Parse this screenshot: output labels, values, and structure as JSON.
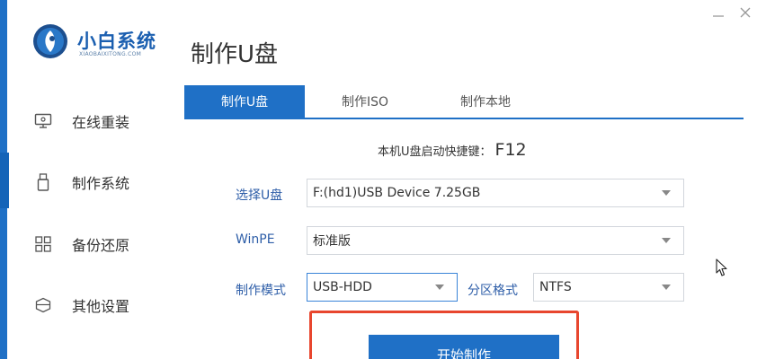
{
  "app": {
    "logo_title": "小白系统",
    "logo_subtitle": "XIAOBAIXITONG.COM"
  },
  "sidebar": {
    "items": [
      {
        "label": "在线重装",
        "icon": "monitor-icon"
      },
      {
        "label": "制作系统",
        "icon": "usb-drive-icon"
      },
      {
        "label": "备份还原",
        "icon": "grid-icon"
      },
      {
        "label": "其他设置",
        "icon": "cube-icon"
      }
    ]
  },
  "page_title": "制作U盘",
  "tabs": [
    {
      "label": "制作U盘",
      "active": true
    },
    {
      "label": "制作ISO",
      "active": false
    },
    {
      "label": "制作本地",
      "active": false
    }
  ],
  "hotkey": {
    "label": "本机U盘启动快捷键：",
    "key": "F12"
  },
  "form": {
    "usb_label": "选择U盘",
    "usb_value": "F:(hd1)USB Device 7.25GB",
    "winpe_label": "WinPE",
    "winpe_value": "标准版",
    "mode_label": "制作模式",
    "mode_value": "USB-HDD",
    "partition_label": "分区格式",
    "partition_value": "NTFS"
  },
  "start_button_label": "开始制作",
  "colors": {
    "accent": "#1f70c6",
    "highlight": "#e8462e",
    "label_blue": "#2e5ea8"
  }
}
